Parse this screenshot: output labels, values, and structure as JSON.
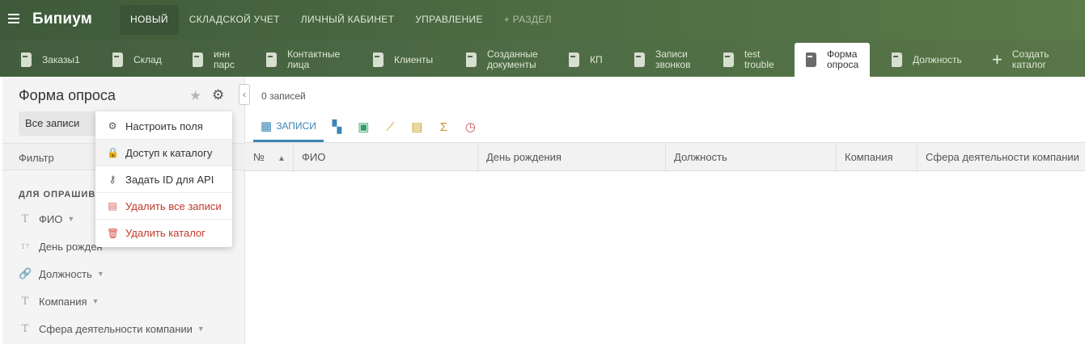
{
  "brand": "Бипиум",
  "topnav": [
    "НОВЫЙ",
    "СКЛАДСКОЙ УЧЕТ",
    "ЛИЧНЫЙ КАБИНЕТ",
    "УПРАВЛЕНИЕ",
    "+ РАЗДЕЛ"
  ],
  "tabs": [
    {
      "label": "Заказы1"
    },
    {
      "label": "Склад"
    },
    {
      "label": "инн\nпарс"
    },
    {
      "label": "Контактные\nлица"
    },
    {
      "label": "Клиенты"
    },
    {
      "label": "Созданные\nдокументы"
    },
    {
      "label": "КП"
    },
    {
      "label": "Записи\nзвонков"
    },
    {
      "label": "test\ntrouble"
    },
    {
      "label": "Форма\nопроса"
    },
    {
      "label": "Должность"
    },
    {
      "label": "Создать\nкаталог"
    }
  ],
  "catalog": {
    "title": "Форма опроса",
    "view_select": "Все записи",
    "filter_label": "Фильтр",
    "group_title": "ДЛЯ ОПРАШИВ",
    "fields": [
      "ФИО",
      "День рожден",
      "Должность",
      "Компания",
      "Сфера деятельности компании"
    ],
    "field_icons": [
      "T",
      "17",
      "🔗",
      "T",
      "T"
    ]
  },
  "menu": [
    "Настроить поля",
    "Доступ к каталогу",
    "Задать ID для API",
    "Удалить все записи",
    "Удалить каталог"
  ],
  "main": {
    "records_count": "0 записей",
    "view_tab_active": "ЗАПИСИ",
    "columns": [
      "№",
      "ФИО",
      "День рождения",
      "Должность",
      "Компания",
      "Сфера деятельности компании"
    ]
  },
  "colors": {
    "accent": "#3a86b6",
    "danger": "#c0392b",
    "header_green": "#4c6b42"
  }
}
